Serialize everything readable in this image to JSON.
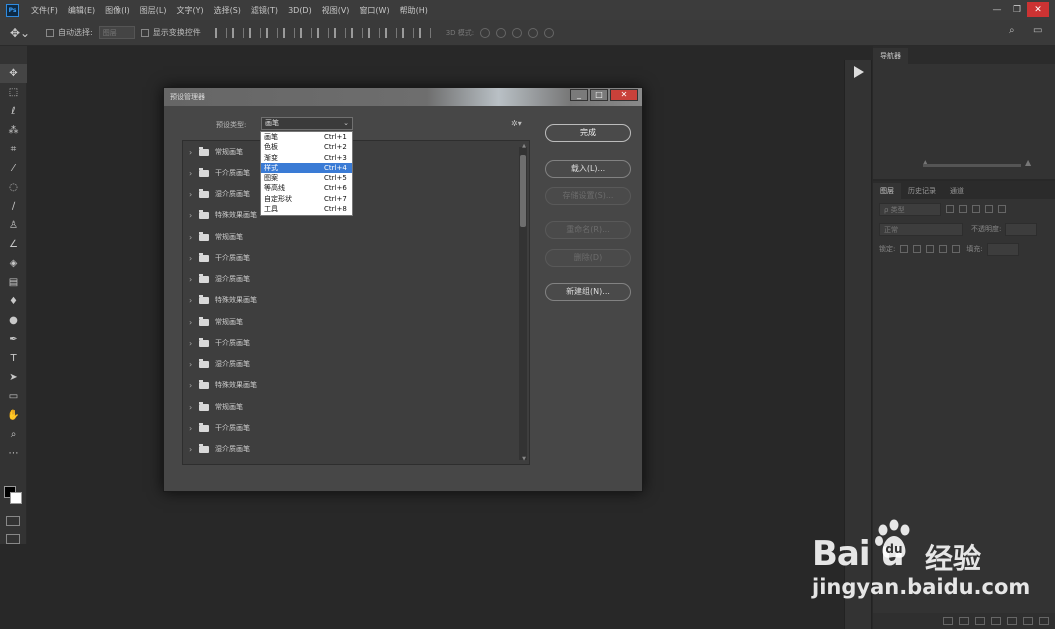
{
  "menubar": {
    "logo": "Ps",
    "items": [
      "文件(F)",
      "编辑(E)",
      "图像(I)",
      "图层(L)",
      "文字(Y)",
      "选择(S)",
      "滤镜(T)",
      "3D(D)",
      "视图(V)",
      "窗口(W)",
      "帮助(H)"
    ]
  },
  "window_controls": {
    "minimize": "—",
    "restore": "❐",
    "close": "✕"
  },
  "options_bar": {
    "auto_select_label": "自动选择:",
    "auto_select_value": "图层",
    "show_transform_label": "显示变换控件",
    "mode_3d_label": "3D 模式:"
  },
  "panels": {
    "navigator_tab": "导航器",
    "layers_tabs": [
      "图层",
      "历史记录",
      "通道"
    ],
    "kind_placeholder": "ρ 类型",
    "blend_mode": "正常",
    "opacity_label": "不透明度:",
    "lock_label": "锁定:",
    "fill_label": "填充:"
  },
  "dialog": {
    "title": "预设管理器",
    "preset_type_label": "预设类型:",
    "preset_type_value": "画笔",
    "buttons": {
      "done": "完成",
      "load": "载入(L)...",
      "save": "存储设置(S)...",
      "rename": "重命名(R)...",
      "delete": "删除(D)",
      "new_group": "新建组(N)..."
    },
    "list_items": [
      "常规画笔",
      "干介质画笔",
      "湿介质画笔",
      "特殊效果画笔",
      "常规画笔",
      "干介质画笔",
      "湿介质画笔",
      "特殊效果画笔",
      "常规画笔",
      "干介质画笔",
      "湿介质画笔",
      "特殊效果画笔",
      "常规画笔",
      "干介质画笔",
      "湿介质画笔"
    ],
    "dropdown_options": [
      {
        "label": "画笔",
        "shortcut": "Ctrl+1"
      },
      {
        "label": "色板",
        "shortcut": "Ctrl+2"
      },
      {
        "label": "渐变",
        "shortcut": "Ctrl+3"
      },
      {
        "label": "样式",
        "shortcut": "Ctrl+4"
      },
      {
        "label": "图案",
        "shortcut": "Ctrl+5"
      },
      {
        "label": "等高线",
        "shortcut": "Ctrl+6"
      },
      {
        "label": "自定形状",
        "shortcut": "Ctrl+7"
      },
      {
        "label": "工具",
        "shortcut": "Ctrl+8"
      }
    ],
    "selected_option": "样式"
  },
  "watermark": {
    "brand": "Bai  u",
    "product": "经验",
    "url": "jingyan.baidu.com"
  },
  "colors": {
    "selection_blue": "#3a7bd5",
    "close_red": "#c9413a",
    "workspace": "#282828"
  }
}
